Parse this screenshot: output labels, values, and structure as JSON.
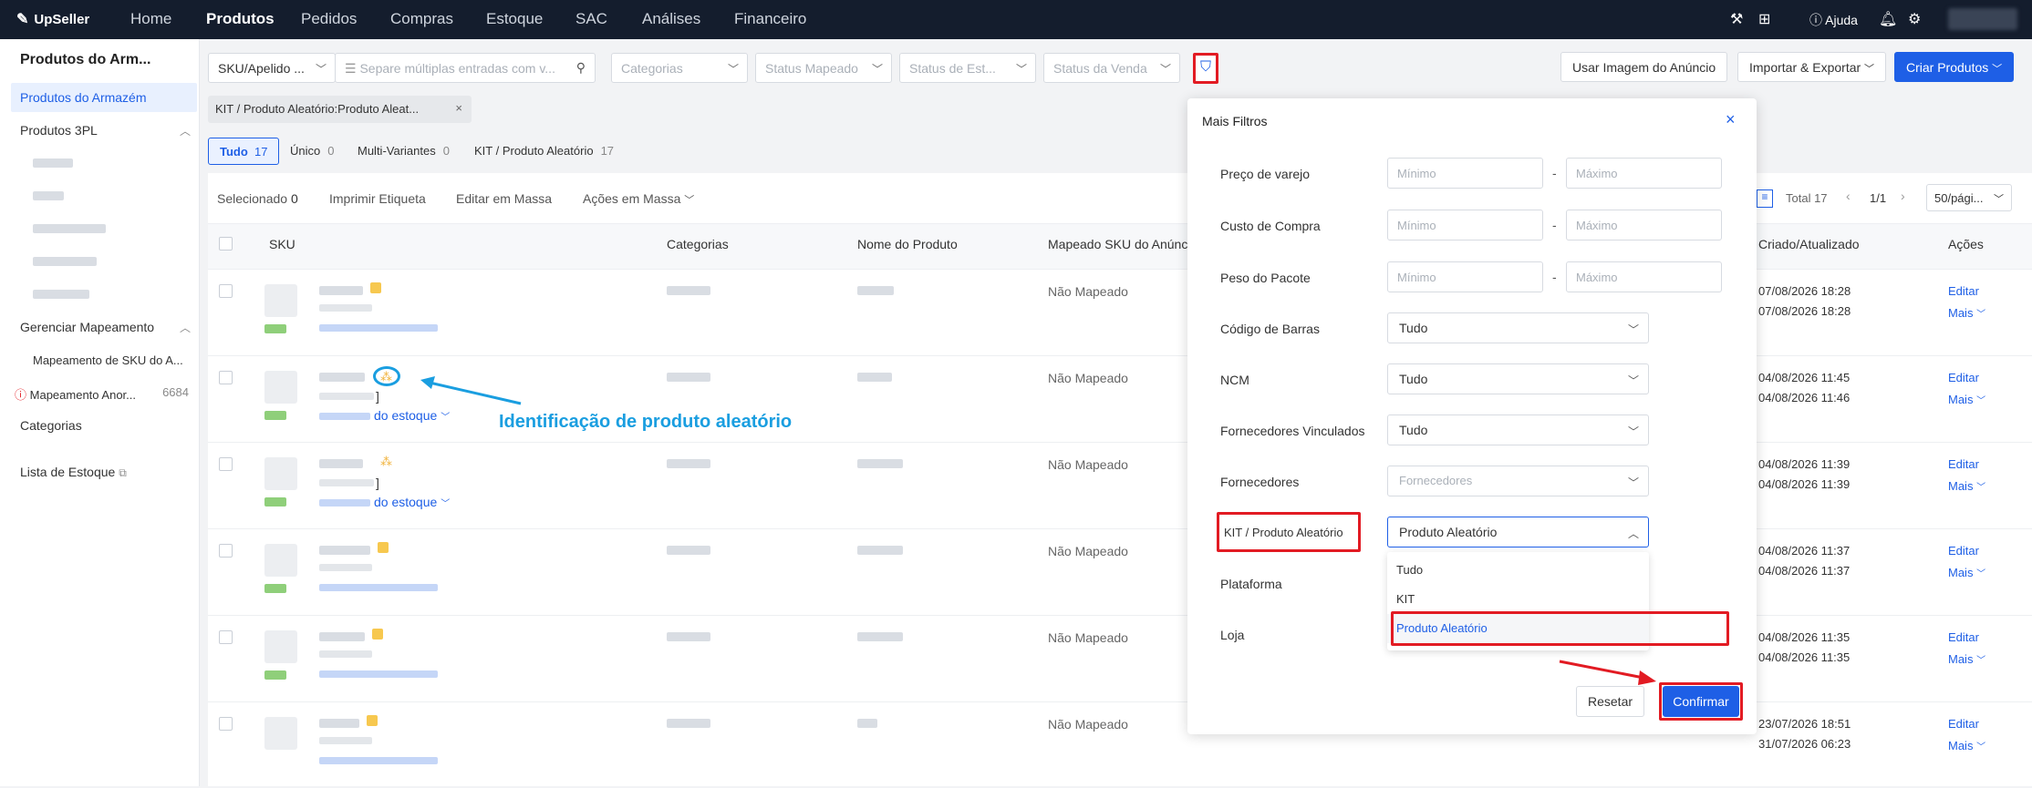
{
  "topbar": {
    "logo": "UpSeller",
    "nav": [
      "Home",
      "Produtos",
      "Pedidos",
      "Compras",
      "Estoque",
      "SAC",
      "Análises",
      "Financeiro"
    ],
    "help": "Ajuda"
  },
  "sidebar": {
    "title": "Produtos do Arm...",
    "active": "Produtos do Armazém",
    "group3pl": "Produtos 3PL",
    "mapping_group": "Gerenciar Mapeamento",
    "mapping_sku": "Mapeamento de SKU do A...",
    "mapping_anom": "Mapeamento Anor...",
    "mapping_anom_count": "6684",
    "categories": "Categorias",
    "stock_list": "Lista de Estoque"
  },
  "filters": {
    "sku_select": "SKU/Apelido ...",
    "search_placeholder": "Separe múltiplas entradas com v...",
    "categorias": "Categorias",
    "status_mapeado": "Status Mapeado",
    "status_estoque": "Status de Est...",
    "status_venda": "Status da Venda",
    "chip": "KIT / Produto Aleatório:Produto Aleat..."
  },
  "actions": {
    "usar_imagem": "Usar Imagem do Anúncio",
    "importar": "Importar & Exportar",
    "criar": "Criar Produtos"
  },
  "tabs": [
    {
      "label": "Tudo",
      "count": "17"
    },
    {
      "label": "Único",
      "count": "0"
    },
    {
      "label": "Multi-Variantes",
      "count": "0"
    },
    {
      "label": "KIT / Produto Aleatório",
      "count": "17"
    }
  ],
  "toolbar": {
    "selected_label": "Selecionado",
    "selected_count": "0",
    "print": "Imprimir Etiqueta",
    "bulk_edit": "Editar em Massa",
    "bulk_actions": "Ações em Massa",
    "total": "Total 17",
    "page": "1/1",
    "per_page": "50/pági..."
  },
  "table": {
    "headers": {
      "sku": "SKU",
      "categorias": "Categorias",
      "nome": "Nome do Produto",
      "mapeado": "Mapeado SKU do Anúnc",
      "criado": "Criado/Atualizado",
      "acoes": "Ações"
    },
    "rows": [
      {
        "mapeado": "Não Mapeado",
        "created": "07/08/2026 18:28",
        "updated": "07/08/2026 18:28"
      },
      {
        "mapeado": "Não Mapeado",
        "created": "04/08/2026 11:45",
        "updated": "04/08/2026 11:46"
      },
      {
        "mapeado": "Não Mapeado",
        "created": "04/08/2026 11:39",
        "updated": "04/08/2026 11:39"
      },
      {
        "mapeado": "Não Mapeado",
        "created": "04/08/2026 11:37",
        "updated": "04/08/2026 11:37"
      },
      {
        "mapeado": "Não Mapeado",
        "created": "04/08/2026 11:35",
        "updated": "04/08/2026 11:35"
      },
      {
        "mapeado": "Não Mapeado",
        "created": "23/07/2026 18:51",
        "updated": "31/07/2026 06:23"
      }
    ],
    "edit": "Editar",
    "more": "Mais",
    "stock_detail": "do estoque",
    "bracket": "]"
  },
  "annotation": "Identificação de produto aleatório",
  "panel": {
    "title": "Mais Filtros",
    "preco": "Preço de varejo",
    "custo": "Custo de Compra",
    "peso": "Peso do Pacote",
    "min": "Mínimo",
    "max": "Máximo",
    "dash": "-",
    "codigo": "Código de Barras",
    "ncm": "NCM",
    "forn_vinc": "Fornecedores Vinculados",
    "forn": "Fornecedores",
    "forn_placeholder": "Fornecedores",
    "kit": "KIT / Produto Aleatório",
    "plataforma": "Plataforma",
    "loja": "Loja",
    "tudo": "Tudo",
    "kit_selected": "Produto Aleatório",
    "options": [
      "Tudo",
      "KIT",
      "Produto Aleatório"
    ],
    "reset": "Resetar",
    "confirm": "Confirmar"
  },
  "colors": {
    "accent": "#1e5fe6",
    "highlight": "#e21b23",
    "annotation": "#1a9ee0",
    "topbar": "#141d2d"
  }
}
